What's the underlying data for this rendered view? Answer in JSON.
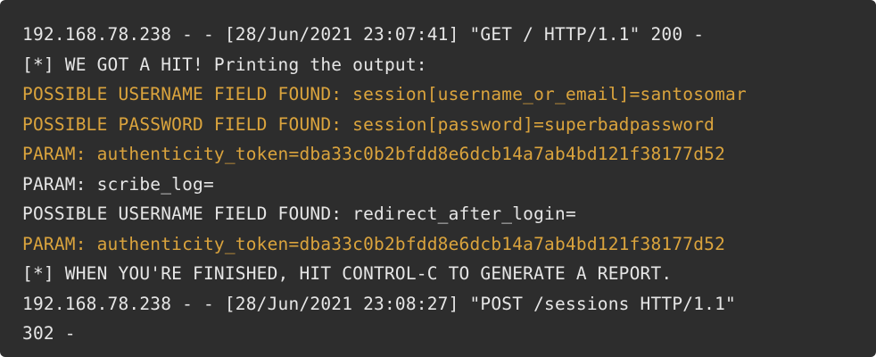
{
  "colors": {
    "background": "#2d2d2d",
    "text": "#e6e6e6",
    "highlight": "#dba43d"
  },
  "terminal": {
    "lines": [
      {
        "text": "192.168.78.238 - - [28/Jun/2021 23:07:41] \"GET / HTTP/1.1\" 200 -",
        "style": "normal"
      },
      {
        "text": "[*] WE GOT A HIT! Printing the output:",
        "style": "normal"
      },
      {
        "text": "POSSIBLE USERNAME FIELD FOUND: session[username_or_email]=santosomar",
        "style": "highlight"
      },
      {
        "text": "POSSIBLE PASSWORD FIELD FOUND: session[password]=superbadpassword",
        "style": "highlight"
      },
      {
        "text": "PARAM: authenticity_token=dba33c0b2bfdd8e6dcb14a7ab4bd121f38177d52",
        "style": "highlight"
      },
      {
        "text": "PARAM: scribe_log=",
        "style": "normal"
      },
      {
        "text": "POSSIBLE USERNAME FIELD FOUND: redirect_after_login=",
        "style": "normal"
      },
      {
        "text": "PARAM: authenticity_token=dba33c0b2bfdd8e6dcb14a7ab4bd121f38177d52",
        "style": "highlight"
      },
      {
        "text": "[*] WHEN YOU'RE FINISHED, HIT CONTROL-C TO GENERATE A REPORT.",
        "style": "normal"
      },
      {
        "text": "192.168.78.238 - - [28/Jun/2021 23:08:27] \"POST /sessions HTTP/1.1\"",
        "style": "normal"
      },
      {
        "text": "302 -",
        "style": "normal"
      }
    ]
  }
}
